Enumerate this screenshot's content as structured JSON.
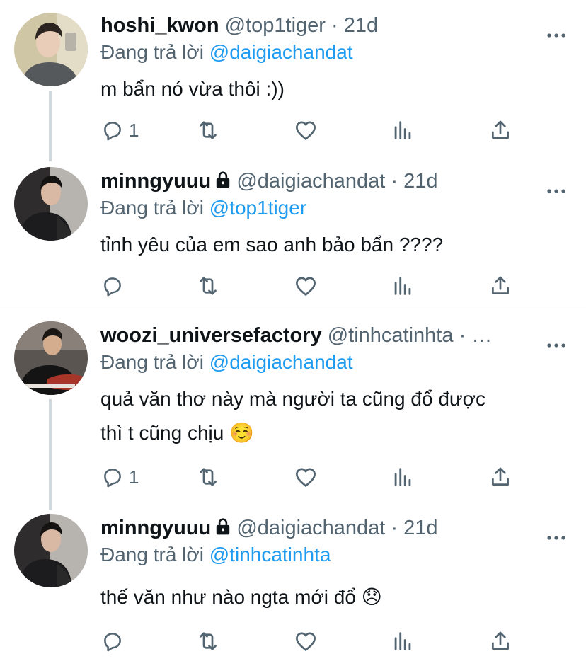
{
  "reply_prefix": "Đang trả lời",
  "tweets": [
    {
      "name": "hoshi_kwon",
      "locked": false,
      "handle": "@top1tiger",
      "separator": "·",
      "time": "21d",
      "reply_to": "@daigiachandat",
      "text": "m bẩn nó vừa thôi :))",
      "reply_count": "1"
    },
    {
      "name": "minngyuuu",
      "locked": true,
      "handle": "@daigiachandat",
      "separator": "·",
      "time": "21d",
      "reply_to": "@top1tiger",
      "text": "tỉnh yêu của em sao anh bảo bẩn ????",
      "reply_count": ""
    },
    {
      "name": "woozi_universefactory",
      "locked": false,
      "handle": "@tinhcatinhta",
      "separator": "·",
      "time": "…",
      "reply_to": "@daigiachandat",
      "text_line1": "quả văn thơ này mà người ta cũng đổ được",
      "text_line2": "thì t cũng chịu ☺️",
      "reply_count": "1"
    },
    {
      "name": "minngyuuu",
      "locked": true,
      "handle": "@daigiachandat",
      "separator": "·",
      "time": "21d",
      "reply_to": "@tinhcatinhta",
      "text": "thế văn như nào ngta mới đổ 😞",
      "reply_count": ""
    }
  ],
  "colors": {
    "link": "#1d9bf0",
    "secondary": "#536471",
    "thread_line": "#cfd9de",
    "divider": "#eff3f4"
  },
  "icons": [
    "reply-icon",
    "retweet-icon",
    "like-icon",
    "analytics-icon",
    "share-icon",
    "more-icon",
    "lock-icon"
  ]
}
